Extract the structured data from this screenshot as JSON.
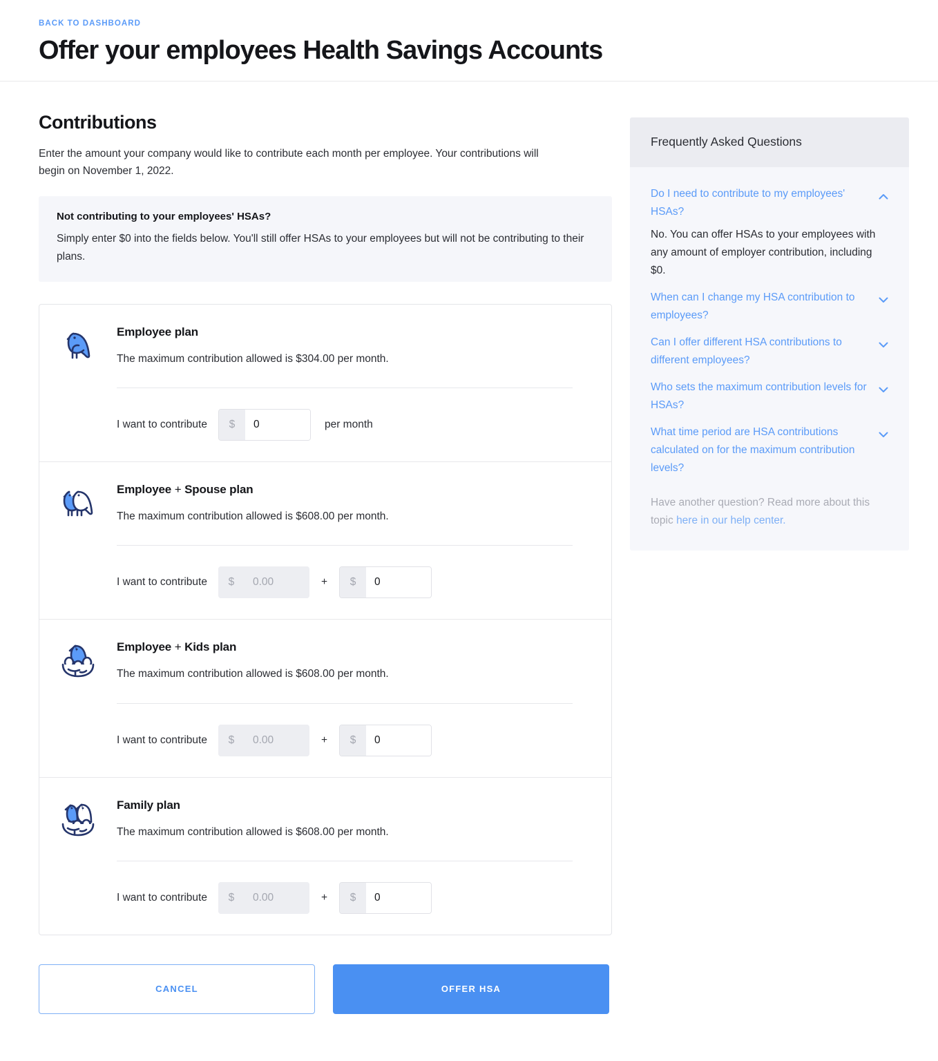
{
  "header": {
    "back_link": "BACK TO DASHBOARD",
    "title": "Offer your employees Health Savings Accounts"
  },
  "contributions": {
    "section_title": "Contributions",
    "description": "Enter the amount your company would like to contribute each month per employee. Your contributions will begin on November 1, 2022.",
    "notice": {
      "title": "Not contributing to your employees' HSAs?",
      "body": "Simply enter $0 into the fields below. You'll still offer HSAs to your employees but will not be contributing to their plans."
    },
    "contribute_label": "I want to contribute",
    "per_month_label": "per month",
    "plus_separator": "+",
    "currency_symbol": "$",
    "plans": [
      {
        "icon": "single-bird-icon",
        "name_prefix": "Employee",
        "name_plus": "",
        "name_suffix": " plan",
        "max_text": "The maximum contribution allowed is $304.00 per month.",
        "fields": [
          {
            "value": "0",
            "placeholder": "",
            "disabled": false
          }
        ],
        "trailing": "per month"
      },
      {
        "icon": "two-birds-icon",
        "name_prefix": "Employee",
        "name_plus": " + ",
        "name_suffix": "Spouse plan",
        "max_text": "The maximum contribution allowed is $608.00 per month.",
        "fields": [
          {
            "value": "",
            "placeholder": "0.00",
            "disabled": true
          },
          {
            "value": "0",
            "placeholder": "",
            "disabled": false
          }
        ],
        "trailing": ""
      },
      {
        "icon": "bird-nest-icon",
        "name_prefix": "Employee",
        "name_plus": " + ",
        "name_suffix": "Kids plan",
        "max_text": "The maximum contribution allowed is $608.00 per month.",
        "fields": [
          {
            "value": "",
            "placeholder": "0.00",
            "disabled": true
          },
          {
            "value": "0",
            "placeholder": "",
            "disabled": false
          }
        ],
        "trailing": ""
      },
      {
        "icon": "family-nest-icon",
        "name_prefix": "Family plan",
        "name_plus": "",
        "name_suffix": "",
        "max_text": "The maximum contribution allowed is $608.00 per month.",
        "fields": [
          {
            "value": "",
            "placeholder": "0.00",
            "disabled": true
          },
          {
            "value": "0",
            "placeholder": "",
            "disabled": false
          }
        ],
        "trailing": ""
      }
    ]
  },
  "actions": {
    "cancel_label": "CANCEL",
    "submit_label": "OFFER HSA"
  },
  "faq": {
    "header": "Frequently Asked Questions",
    "items": [
      {
        "question": "Do I need to contribute to my employees' HSAs?",
        "answer": "No. You can offer HSAs to your employees with any amount of employer contribution, including $0.",
        "expanded": true
      },
      {
        "question": "When can I change my HSA contribution to employees?",
        "answer": "",
        "expanded": false
      },
      {
        "question": "Can I offer different HSA contributions to different employees?",
        "answer": "",
        "expanded": false
      },
      {
        "question": "Who sets the maximum contribution levels for HSAs?",
        "answer": "",
        "expanded": false
      },
      {
        "question": "What time period are HSA contributions calculated on for the maximum contribution levels?",
        "answer": "",
        "expanded": false
      }
    ],
    "footer_text": "Have another question? Read more about this topic ",
    "footer_link": "here in our help center."
  },
  "colors": {
    "accent_blue": "#4a90f2",
    "link_blue": "#5b9bf8",
    "bird_blue": "#5b9bf8",
    "bird_outline": "#25356b",
    "notice_bg": "#f5f6fa",
    "faq_bg": "#f6f7fb",
    "faq_header_bg": "#ebecf1"
  }
}
